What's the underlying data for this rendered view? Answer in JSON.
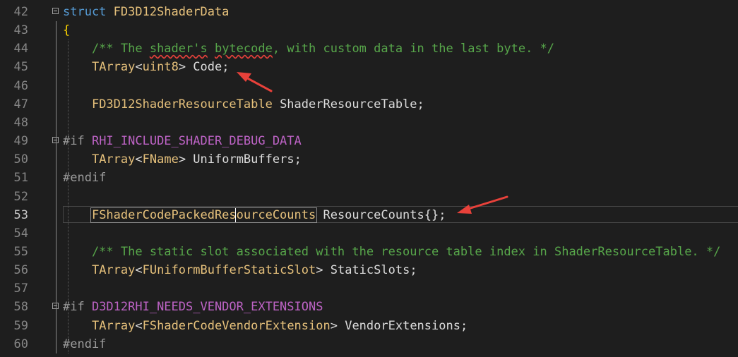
{
  "editor": {
    "lines": [
      {
        "n": "42",
        "tokens": [
          {
            "t": "struct ",
            "c": "kw"
          },
          {
            "t": "FD3D12ShaderData",
            "c": "ty"
          }
        ],
        "fold": true
      },
      {
        "n": "43",
        "tokens": [
          {
            "t": "{",
            "c": "brace"
          }
        ]
      },
      {
        "n": "44",
        "tokens": [
          {
            "t": "    /** The ",
            "c": "comment"
          },
          {
            "t": "shader's",
            "c": "comment squiggle"
          },
          {
            "t": " ",
            "c": "comment"
          },
          {
            "t": "bytecode",
            "c": "comment squiggle"
          },
          {
            "t": ", with custom data in the last byte. */",
            "c": "comment"
          }
        ]
      },
      {
        "n": "45",
        "tokens": [
          {
            "t": "    ",
            "c": "var"
          },
          {
            "t": "TArray",
            "c": "ty"
          },
          {
            "t": "<",
            "c": "var"
          },
          {
            "t": "uint8",
            "c": "ty"
          },
          {
            "t": "> Code;",
            "c": "var"
          }
        ]
      },
      {
        "n": "46",
        "tokens": []
      },
      {
        "n": "47",
        "tokens": [
          {
            "t": "    ",
            "c": "var"
          },
          {
            "t": "FD3D12ShaderResourceTable",
            "c": "ty"
          },
          {
            "t": " ShaderResourceTable;",
            "c": "var"
          }
        ]
      },
      {
        "n": "48",
        "tokens": []
      },
      {
        "n": "49",
        "tokens": [
          {
            "t": "#if ",
            "c": "pp"
          },
          {
            "t": "RHI_INCLUDE_SHADER_DEBUG_DATA",
            "c": "macro"
          }
        ],
        "fold": true,
        "pp": true
      },
      {
        "n": "50",
        "tokens": [
          {
            "t": "    ",
            "c": "var"
          },
          {
            "t": "TArray",
            "c": "ty"
          },
          {
            "t": "<",
            "c": "var"
          },
          {
            "t": "FName",
            "c": "ty"
          },
          {
            "t": "> UniformBuffers;",
            "c": "var"
          }
        ]
      },
      {
        "n": "51",
        "tokens": [
          {
            "t": "#endif",
            "c": "pp"
          }
        ],
        "pp": true
      },
      {
        "n": "52",
        "tokens": []
      },
      {
        "n": "53",
        "tokens": [
          {
            "t": "    ",
            "c": "var"
          },
          {
            "t": "FShaderCodePackedResourceCounts",
            "c": "ty hl"
          },
          {
            "t": " ResourceCounts{};",
            "c": "var"
          }
        ],
        "current": true
      },
      {
        "n": "54",
        "tokens": []
      },
      {
        "n": "55",
        "tokens": [
          {
            "t": "    /** The static slot associated with the resource table index in ShaderResourceTable. */",
            "c": "comment"
          }
        ]
      },
      {
        "n": "56",
        "tokens": [
          {
            "t": "    ",
            "c": "var"
          },
          {
            "t": "TArray",
            "c": "ty"
          },
          {
            "t": "<",
            "c": "var"
          },
          {
            "t": "FUniformBufferStaticSlot",
            "c": "ty"
          },
          {
            "t": "> StaticSlots;",
            "c": "var"
          }
        ]
      },
      {
        "n": "57",
        "tokens": []
      },
      {
        "n": "58",
        "tokens": [
          {
            "t": "#if ",
            "c": "pp"
          },
          {
            "t": "D3D12RHI_NEEDS_VENDOR_EXTENSIONS",
            "c": "macro"
          }
        ],
        "fold": true,
        "pp": true
      },
      {
        "n": "59",
        "tokens": [
          {
            "t": "    ",
            "c": "var"
          },
          {
            "t": "TArray",
            "c": "ty"
          },
          {
            "t": "<",
            "c": "var"
          },
          {
            "t": "FShaderCodeVendorExtension",
            "c": "ty"
          },
          {
            "t": "> VendorExtensions;",
            "c": "var"
          }
        ]
      },
      {
        "n": "60",
        "tokens": [
          {
            "t": "#endif",
            "c": "pp"
          }
        ],
        "pp": true
      }
    ]
  },
  "colors": {
    "background": "#1e1e1e",
    "annotation_arrow": "#e8413a"
  }
}
